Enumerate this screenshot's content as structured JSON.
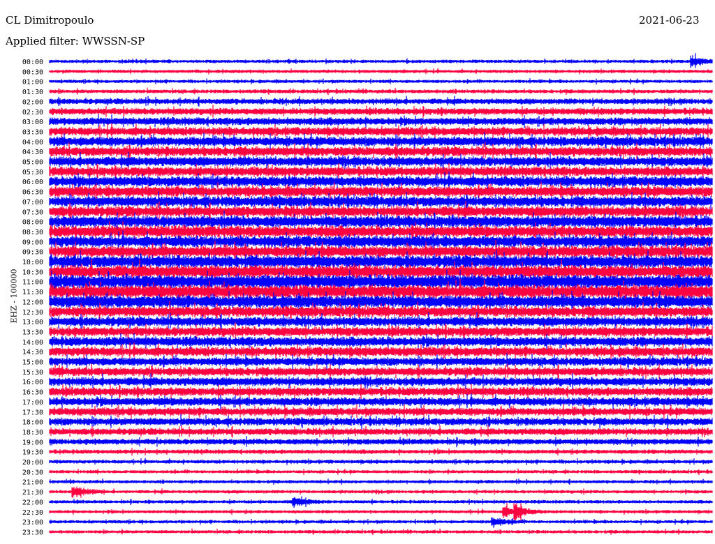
{
  "header": {
    "station": "CL Dimitropoulo",
    "filter": "Applied filter: WWSSN-SP",
    "date": "2021-06-23"
  },
  "chart_data": {
    "type": "line",
    "title": "CL Dimitropoulo",
    "subtitle": "Applied filter: WWSSN-SP",
    "ylabel": "EHZ - 100000",
    "xlabel": "",
    "series_colors": [
      "#0000ff",
      "#ff0040"
    ],
    "row_labels": [
      "00:00",
      "00:30",
      "01:00",
      "01:30",
      "02:00",
      "02:30",
      "03:00",
      "03:30",
      "04:00",
      "04:30",
      "05:00",
      "05:30",
      "06:00",
      "06:30",
      "07:00",
      "07:30",
      "08:00",
      "08:30",
      "09:00",
      "09:30",
      "10:00",
      "10:30",
      "11:00",
      "11:30",
      "12:00",
      "12:30",
      "13:00",
      "13:30",
      "14:00",
      "14:30",
      "15:00",
      "15:30",
      "16:00",
      "16:30",
      "17:00",
      "17:30",
      "18:00",
      "18:30",
      "19:00",
      "19:30",
      "20:00",
      "20:30",
      "21:00",
      "21:30",
      "22:00",
      "22:30",
      "23:00",
      "23:30"
    ],
    "relative_amplitude": [
      0.35,
      0.35,
      0.35,
      0.4,
      0.6,
      0.7,
      0.8,
      0.9,
      1.0,
      1.0,
      1.0,
      1.0,
      1.1,
      1.1,
      1.1,
      1.1,
      1.2,
      1.2,
      1.2,
      1.2,
      1.3,
      1.3,
      1.4,
      1.4,
      1.3,
      1.1,
      1.0,
      1.0,
      1.0,
      1.0,
      0.9,
      0.9,
      0.9,
      0.9,
      0.9,
      0.85,
      0.8,
      0.7,
      0.6,
      0.45,
      0.4,
      0.35,
      0.35,
      0.35,
      0.35,
      0.35,
      0.35,
      0.35
    ],
    "events": [
      {
        "row": 0,
        "minute": 29,
        "strength": 3.5
      },
      {
        "row": 43,
        "minute": 1,
        "strength": 4
      },
      {
        "row": 44,
        "minute": 11,
        "strength": 3
      },
      {
        "row": 45,
        "minute": 21,
        "strength": 3
      },
      {
        "row": 45,
        "minute": 20.5,
        "strength": 3
      },
      {
        "row": 46,
        "minute": 20,
        "strength": 3
      }
    ]
  }
}
